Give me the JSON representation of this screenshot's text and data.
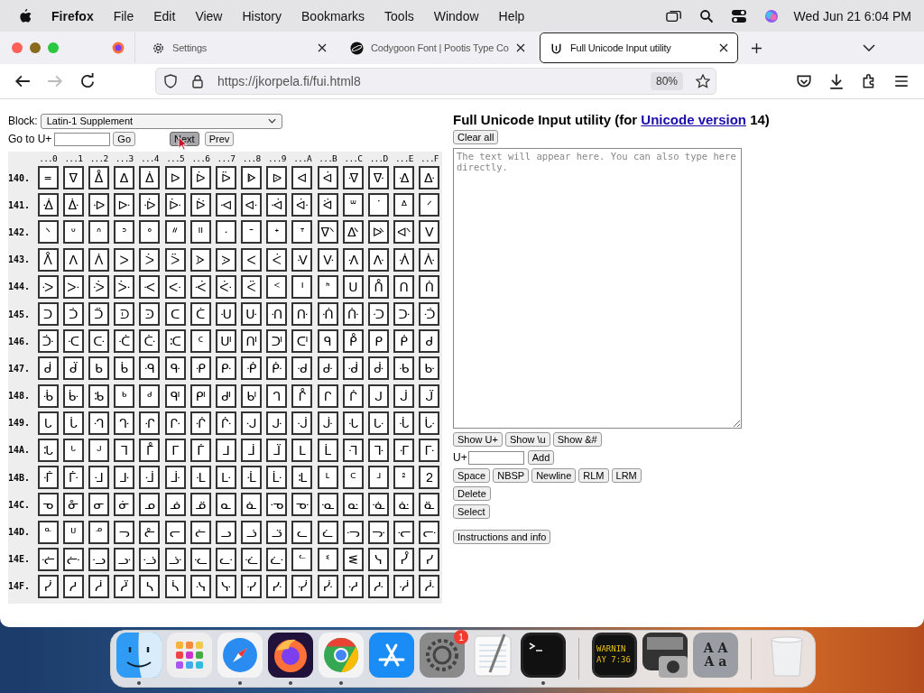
{
  "menubar": {
    "app": "Firefox",
    "menus": [
      "File",
      "Edit",
      "View",
      "History",
      "Bookmarks",
      "Tools",
      "Window",
      "Help"
    ],
    "clock": "Wed Jun 21 6:04 PM"
  },
  "tabs": [
    {
      "kind": "gear",
      "title": "Settings",
      "selected": false
    },
    {
      "kind": "planet",
      "title": "Codygoon Font | Pootis Type Co",
      "selected": false
    },
    {
      "kind": "unicode",
      "title": "Full Unicode Input utility",
      "selected": true
    }
  ],
  "address_bar": {
    "url": "https://jkorpela.fi/fui.html8",
    "zoom": "80%"
  },
  "page": {
    "block_label": "Block:",
    "block_value": "Latin-1 Supplement",
    "goto_label": "Go to U+",
    "nav_buttons": [
      {
        "label": "Go",
        "pressed": false
      },
      {
        "label": "Next",
        "pressed": true
      },
      {
        "label": "Prev",
        "pressed": false
      }
    ],
    "grid": {
      "headers": [
        "...0",
        "...1",
        "...2",
        "...3",
        "...4",
        "...5",
        "...6",
        "...7",
        "...8",
        "...9",
        "...A",
        "...B",
        "...C",
        "...D",
        "...E",
        "...F"
      ],
      "rows": [
        {
          "label": "140.",
          "cells": [
            "᐀",
            "ᐁ",
            "ᐂ",
            "ᐃ",
            "ᐄ",
            "ᐅ",
            "ᐆ",
            "ᐇ",
            "ᐈ",
            "ᐉ",
            "ᐊ",
            "ᐋ",
            "ᐌ",
            "ᐍ",
            "ᐎ",
            "ᐏ"
          ]
        },
        {
          "label": "141.",
          "cells": [
            "ᐐ",
            "ᐑ",
            "ᐒ",
            "ᐓ",
            "ᐔ",
            "ᐕ",
            "ᐖ",
            "ᐗ",
            "ᐘ",
            "ᐙ",
            "ᐚ",
            "ᐛ",
            "ᐜ",
            "ᐝ",
            "ᐞ",
            "ᐟ"
          ]
        },
        {
          "label": "142.",
          "cells": [
            "ᐠ",
            "ᐡ",
            "ᐢ",
            "ᐣ",
            "ᐤ",
            "ᐥ",
            "ᐦ",
            "ᐧ",
            "ᐨ",
            "ᐩ",
            "ᐪ",
            "ᐫ",
            "ᐬ",
            "ᐭ",
            "ᐮ",
            "ᐯ"
          ]
        },
        {
          "label": "143.",
          "cells": [
            "ᐰ",
            "ᐱ",
            "ᐲ",
            "ᐳ",
            "ᐴ",
            "ᐵ",
            "ᐶ",
            "ᐷ",
            "ᐸ",
            "ᐹ",
            "ᐺ",
            "ᐻ",
            "ᐼ",
            "ᐽ",
            "ᐾ",
            "ᐿ"
          ]
        },
        {
          "label": "144.",
          "cells": [
            "ᑀ",
            "ᑁ",
            "ᑂ",
            "ᑃ",
            "ᑄ",
            "ᑅ",
            "ᑆ",
            "ᑇ",
            "ᑈ",
            "ᑉ",
            "ᑊ",
            "ᑋ",
            "ᑌ",
            "ᑍ",
            "ᑎ",
            "ᑏ"
          ]
        },
        {
          "label": "145.",
          "cells": [
            "ᑐ",
            "ᑑ",
            "ᑒ",
            "ᑓ",
            "ᑔ",
            "ᑕ",
            "ᑖ",
            "ᑗ",
            "ᑘ",
            "ᑙ",
            "ᑚ",
            "ᑛ",
            "ᑜ",
            "ᑝ",
            "ᑞ",
            "ᑟ"
          ]
        },
        {
          "label": "146.",
          "cells": [
            "ᑠ",
            "ᑡ",
            "ᑢ",
            "ᑣ",
            "ᑤ",
            "ᑥ",
            "ᑦ",
            "ᑧ",
            "ᑨ",
            "ᑩ",
            "ᑪ",
            "ᑫ",
            "ᑬ",
            "ᑭ",
            "ᑮ",
            "ᑯ"
          ]
        },
        {
          "label": "147.",
          "cells": [
            "ᑰ",
            "ᑱ",
            "ᑲ",
            "ᑳ",
            "ᑴ",
            "ᑵ",
            "ᑶ",
            "ᑷ",
            "ᑸ",
            "ᑹ",
            "ᑺ",
            "ᑻ",
            "ᑼ",
            "ᑽ",
            "ᑾ",
            "ᑿ"
          ]
        },
        {
          "label": "148.",
          "cells": [
            "ᒀ",
            "ᒁ",
            "ᒂ",
            "ᒃ",
            "ᒄ",
            "ᒅ",
            "ᒆ",
            "ᒇ",
            "ᒈ",
            "ᒉ",
            "ᒊ",
            "ᒋ",
            "ᒌ",
            "ᒍ",
            "ᒎ",
            "ᒏ"
          ]
        },
        {
          "label": "149.",
          "cells": [
            "ᒐ",
            "ᒑ",
            "ᒒ",
            "ᒓ",
            "ᒔ",
            "ᒕ",
            "ᒖ",
            "ᒗ",
            "ᒘ",
            "ᒙ",
            "ᒚ",
            "ᒛ",
            "ᒜ",
            "ᒝ",
            "ᒞ",
            "ᒟ"
          ]
        },
        {
          "label": "14A.",
          "cells": [
            "ᒠ",
            "ᒡ",
            "ᒢ",
            "ᒣ",
            "ᒤ",
            "ᒥ",
            "ᒦ",
            "ᒧ",
            "ᒨ",
            "ᒩ",
            "ᒪ",
            "ᒫ",
            "ᒬ",
            "ᒭ",
            "ᒮ",
            "ᒯ"
          ]
        },
        {
          "label": "14B.",
          "cells": [
            "ᒰ",
            "ᒱ",
            "ᒲ",
            "ᒳ",
            "ᒴ",
            "ᒵ",
            "ᒶ",
            "ᒷ",
            "ᒸ",
            "ᒹ",
            "ᒺ",
            "ᒻ",
            "ᒼ",
            "ᒽ",
            "ᒾ",
            "ᒿ"
          ]
        },
        {
          "label": "14C.",
          "cells": [
            "ᓀ",
            "ᓁ",
            "ᓂ",
            "ᓃ",
            "ᓄ",
            "ᓅ",
            "ᓆ",
            "ᓇ",
            "ᓈ",
            "ᓉ",
            "ᓊ",
            "ᓋ",
            "ᓌ",
            "ᓍ",
            "ᓎ",
            "ᓏ"
          ]
        },
        {
          "label": "14D.",
          "cells": [
            "ᓐ",
            "ᓑ",
            "ᓒ",
            "ᓓ",
            "ᓔ",
            "ᓕ",
            "ᓖ",
            "ᓗ",
            "ᓘ",
            "ᓙ",
            "ᓚ",
            "ᓛ",
            "ᓜ",
            "ᓝ",
            "ᓞ",
            "ᓟ"
          ]
        },
        {
          "label": "14E.",
          "cells": [
            "ᓠ",
            "ᓡ",
            "ᓢ",
            "ᓣ",
            "ᓤ",
            "ᓥ",
            "ᓦ",
            "ᓧ",
            "ᓨ",
            "ᓩ",
            "ᓪ",
            "ᓫ",
            "ᓬ",
            "ᓭ",
            "ᓮ",
            "ᓯ"
          ]
        },
        {
          "label": "14F.",
          "cells": [
            "ᓰ",
            "ᓱ",
            "ᓲ",
            "ᓳ",
            "ᓴ",
            "ᓵ",
            "ᓶ",
            "ᓷ",
            "ᓸ",
            "ᓹ",
            "ᓺ",
            "ᓻ",
            "ᓼ",
            "ᓽ",
            "ᓾ",
            "ᓿ"
          ]
        }
      ]
    },
    "title_before": "Full Unicode Input utility (for ",
    "title_link": "Unicode version",
    "title_after": " 14)",
    "clear_button": "Clear all",
    "text_area": {
      "placeholder": "The text will appear here. You can also type here directly."
    },
    "show_buttons": [
      "Show U+",
      "Show \\u",
      "Show &#"
    ],
    "add_label": "U+",
    "add_button": "Add",
    "insert_buttons": [
      "Space",
      "NBSP",
      "Newline",
      "RLM",
      "LRM"
    ],
    "delete_button": "Delete",
    "select_button": "Select",
    "info_button": "Instructions and info"
  },
  "dock": [
    {
      "kind": "finder",
      "running": true
    },
    {
      "kind": "launchpad"
    },
    {
      "kind": "safari",
      "running": true
    },
    {
      "kind": "firefox",
      "running": true
    },
    {
      "kind": "chrome",
      "running": true
    },
    {
      "kind": "appstore"
    },
    {
      "kind": "settings",
      "badge": "1"
    },
    {
      "kind": "textedit"
    },
    {
      "kind": "terminal",
      "running": true
    },
    {
      "kind": "separator"
    },
    {
      "kind": "console",
      "lines": [
        "WARNIN",
        "AY 7:36"
      ]
    },
    {
      "kind": "screenshot"
    },
    {
      "kind": "fontbook",
      "lines": [
        "A A",
        "A a"
      ]
    },
    {
      "kind": "separator"
    },
    {
      "kind": "trash"
    }
  ]
}
